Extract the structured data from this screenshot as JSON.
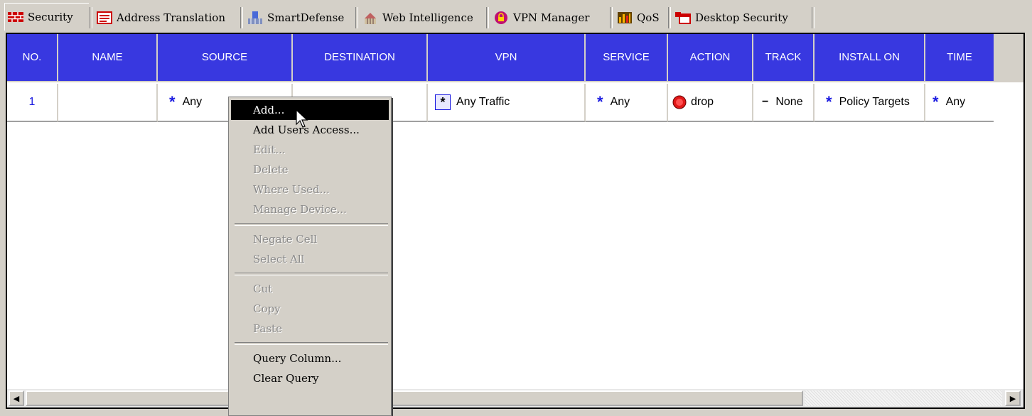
{
  "tabs": [
    {
      "label": "Security",
      "icon": "security-firewall-icon",
      "active": true
    },
    {
      "label": "Address Translation",
      "icon": "address-translation-icon"
    },
    {
      "label": "SmartDefense",
      "icon": "smartdefense-icon"
    },
    {
      "label": "Web Intelligence",
      "icon": "web-intelligence-icon"
    },
    {
      "label": "VPN Manager",
      "icon": "vpn-manager-lock-icon"
    },
    {
      "label": "QoS",
      "icon": "qos-icon"
    },
    {
      "label": "Desktop Security",
      "icon": "desktop-security-icon"
    }
  ],
  "columns": [
    "NO.",
    "NAME",
    "SOURCE",
    "DESTINATION",
    "VPN",
    "SERVICE",
    "ACTION",
    "TRACK",
    "INSTALL ON",
    "TIME"
  ],
  "rule": {
    "no": "1",
    "name": "",
    "source": "Any",
    "destination": "",
    "vpn": "Any Traffic",
    "service": "Any",
    "action": "drop",
    "track": "None",
    "install_on": "Policy Targets",
    "time": "Any"
  },
  "context_menu": {
    "items": [
      {
        "label": "Add...",
        "enabled": true,
        "highlighted": true
      },
      {
        "label": "Add Users Access...",
        "enabled": true
      },
      {
        "label": "Edit...",
        "enabled": false
      },
      {
        "label": "Delete",
        "enabled": false
      },
      {
        "label": "Where Used...",
        "enabled": false
      },
      {
        "label": "Manage Device...",
        "enabled": false
      },
      {
        "label": "Negate Cell",
        "enabled": false
      },
      {
        "label": "Select All",
        "enabled": false
      },
      {
        "label": "Cut",
        "enabled": false
      },
      {
        "label": "Copy",
        "enabled": false
      },
      {
        "label": "Paste",
        "enabled": false
      },
      {
        "label": "Query Column...",
        "enabled": true
      },
      {
        "label": "Clear Query",
        "enabled": true
      }
    ]
  },
  "colors": {
    "header_bg": "#3838e0",
    "accent_star": "#1a1ae0",
    "drop_red": "#e01818"
  }
}
